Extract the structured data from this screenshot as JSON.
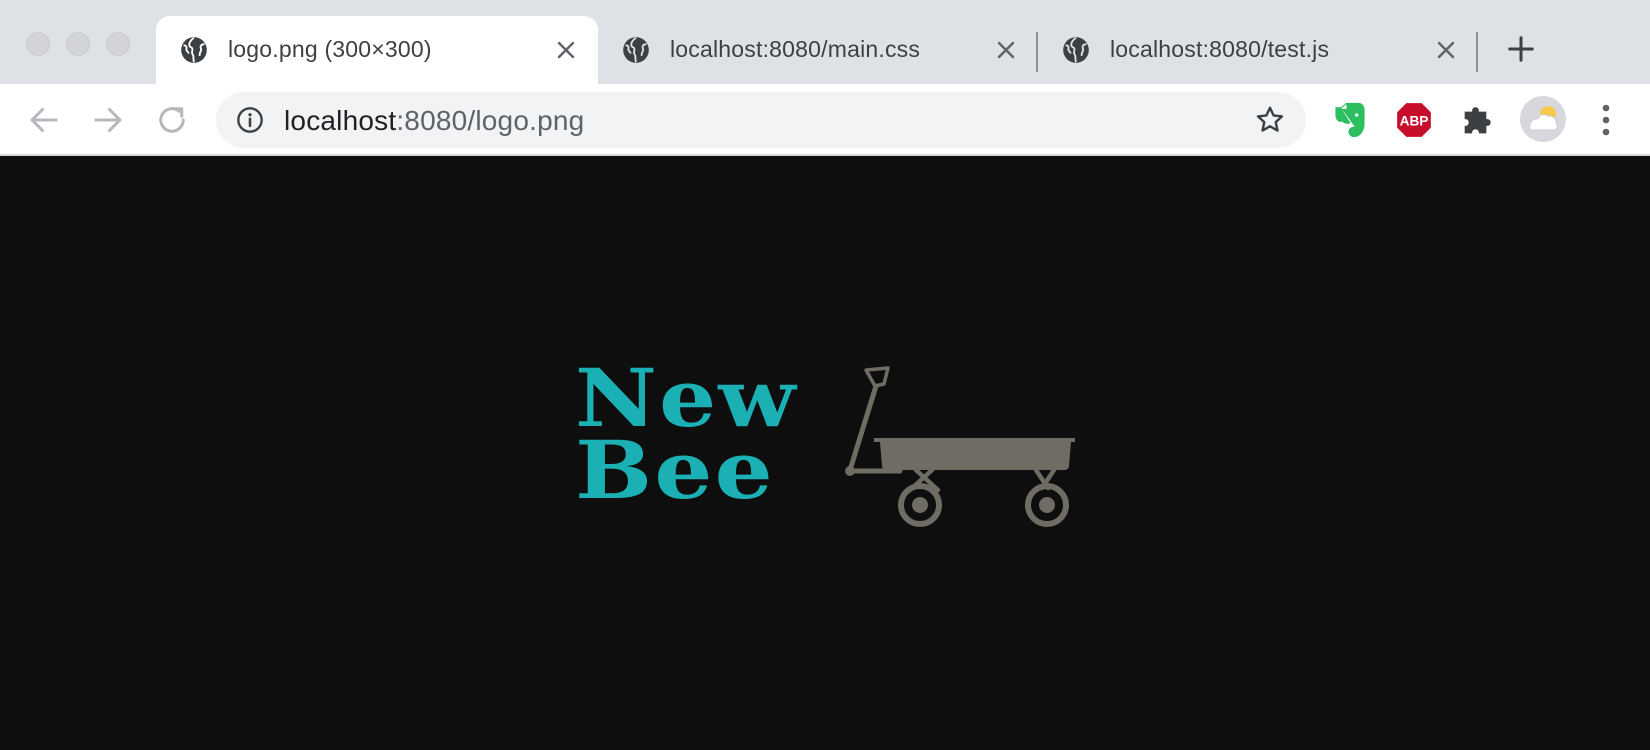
{
  "window": {
    "traffic_lights": [
      "close",
      "minimize",
      "zoom"
    ]
  },
  "tabs": [
    {
      "title": "logo.png (300×300)",
      "active": true,
      "icon": "globe-icon"
    },
    {
      "title": "localhost:8080/main.css",
      "active": false,
      "icon": "globe-icon"
    },
    {
      "title": "localhost:8080/test.js",
      "active": false,
      "icon": "globe-icon"
    }
  ],
  "toolbar": {
    "back_icon": "arrow-left-icon",
    "forward_icon": "arrow-right-icon",
    "reload_icon": "reload-icon",
    "url_host": "localhost",
    "url_rest": ":8080/logo.png",
    "site_info_icon": "info-icon",
    "bookmark_icon": "star-icon",
    "extensions": [
      {
        "name": "Evernote",
        "icon": "evernote-icon",
        "color": "#2dbe60"
      },
      {
        "name": "AdBlock Plus",
        "icon": "abp-icon",
        "label": "ABP",
        "color": "#c70d2c"
      },
      {
        "name": "Extensions",
        "icon": "puzzle-icon",
        "color": "#5f6368"
      }
    ],
    "menu_icon": "more-vertical-icon"
  },
  "content": {
    "background": "#0e0e0e",
    "logo": {
      "line1": "New",
      "line2": "Bee",
      "text_color": "#1bb0b3",
      "wagon_color": "#6e6c63",
      "wagon_icon": "wagon-icon"
    }
  }
}
